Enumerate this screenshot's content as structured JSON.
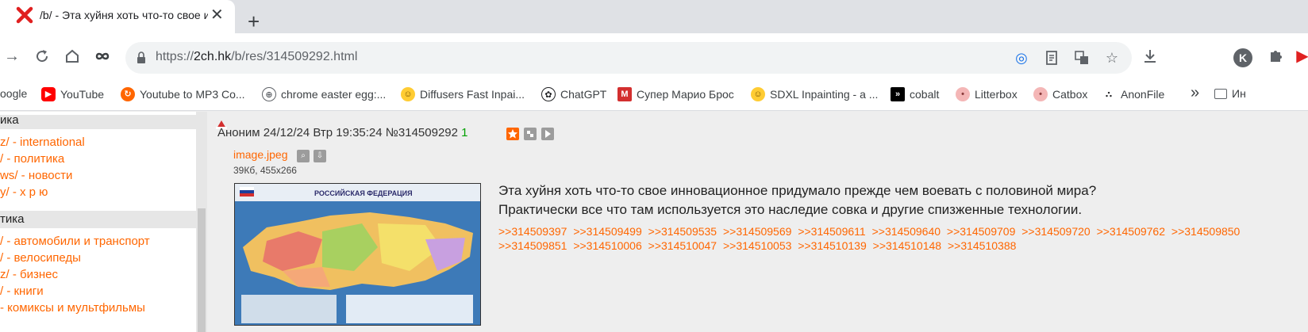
{
  "tab": {
    "title": "/b/ - Эта хуйня хоть что-то свое иннова",
    "close": "✕"
  },
  "new_tab": "+",
  "address": {
    "scheme": "https://",
    "host": "2ch.hk",
    "path": "/b/res/314509292.html"
  },
  "profile_initial": "K",
  "bookmarks": [
    {
      "label": "oogle",
      "icon": "google-icon",
      "color": "#4285f4"
    },
    {
      "label": "YouTube",
      "icon": "youtube-icon",
      "color": "#ff0000"
    },
    {
      "label": "Youtube to MP3 Co...",
      "icon": "refresh-orange-icon",
      "color": "#ff6600"
    },
    {
      "label": "chrome easter egg:...",
      "icon": "globe-icon",
      "color": "#5f6368"
    },
    {
      "label": "Diffusers Fast Inpai...",
      "icon": "hugging-face-icon",
      "color": "#ffcc33"
    },
    {
      "label": "ChatGPT",
      "icon": "openai-icon",
      "color": "#202124"
    },
    {
      "label": "Супер Марио Брос",
      "icon": "mario-icon",
      "color": "#d32f2f"
    },
    {
      "label": "SDXL Inpainting - a ...",
      "icon": "hugging-face-icon",
      "color": "#ffcc33"
    },
    {
      "label": "cobalt",
      "icon": "cobalt-icon",
      "color": "#000000"
    },
    {
      "label": "Litterbox",
      "icon": "litterbox-icon",
      "color": "#f4b6b6"
    },
    {
      "label": "Catbox",
      "icon": "catbox-icon",
      "color": "#f4b6b6"
    },
    {
      "label": "AnonFile",
      "icon": "anonfile-icon",
      "color": "#202124"
    }
  ],
  "bookmarks_more": "»",
  "bookmarks_folder": "Ин",
  "sidebar": {
    "head1": "ика",
    "links1": [
      "z/ - international",
      "/ - политика",
      "ws/ - новости",
      "y/ - х р ю"
    ],
    "head2": "тика",
    "links2": [
      "/ - автомобили и транспорт",
      "/ - велосипеды",
      "z/ - бизнес",
      "/ - книги",
      "- комиксы и мультфильмы"
    ]
  },
  "post": {
    "author": "Аноним",
    "date": "24/12/24 Втр 19:35:24",
    "number": "№314509292",
    "replies_count": "1",
    "file_name": "image.jpeg",
    "file_meta": "39Кб, 455x266",
    "map_title": "РОССИЙСКАЯ ФЕДЕРАЦИЯ",
    "line1": "Эта хуйня хоть что-то свое инновационное придумало прежде чем воевать с половиной мира?",
    "line2": "Практически все что там используется это наследие совка и другие спизженные технологии.",
    "reply_links": [
      ">>314509397",
      ">>314509499",
      ">>314509535",
      ">>314509569",
      ">>314509611",
      ">>314509640",
      ">>314509709",
      ">>314509720",
      ">>314509762",
      ">>314509850",
      ">>314509851",
      ">>314510006",
      ">>314510047",
      ">>314510053",
      ">>314510139",
      ">>314510148",
      ">>314510388"
    ]
  }
}
